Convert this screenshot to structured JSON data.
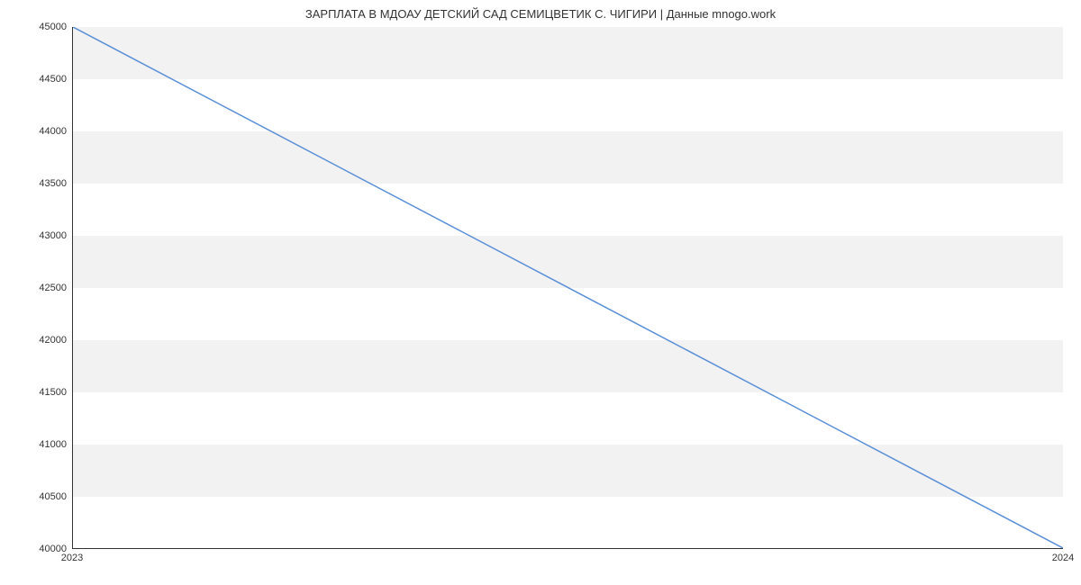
{
  "chart_data": {
    "type": "line",
    "title": "ЗАРПЛАТА В МДОАУ ДЕТСКИЙ САД СЕМИЦВЕТИК С. ЧИГИРИ | Данные mnogo.work",
    "x": [
      2023,
      2024
    ],
    "y": [
      45000,
      40000
    ],
    "xlabel": "",
    "ylabel": "",
    "xlim": [
      2023,
      2024
    ],
    "ylim": [
      40000,
      45000
    ],
    "x_ticks": [
      2023,
      2024
    ],
    "y_ticks": [
      40000,
      40500,
      41000,
      41500,
      42000,
      42500,
      43000,
      43500,
      44000,
      44500,
      45000
    ],
    "grid": true,
    "line_color": "#5a8fd8"
  }
}
